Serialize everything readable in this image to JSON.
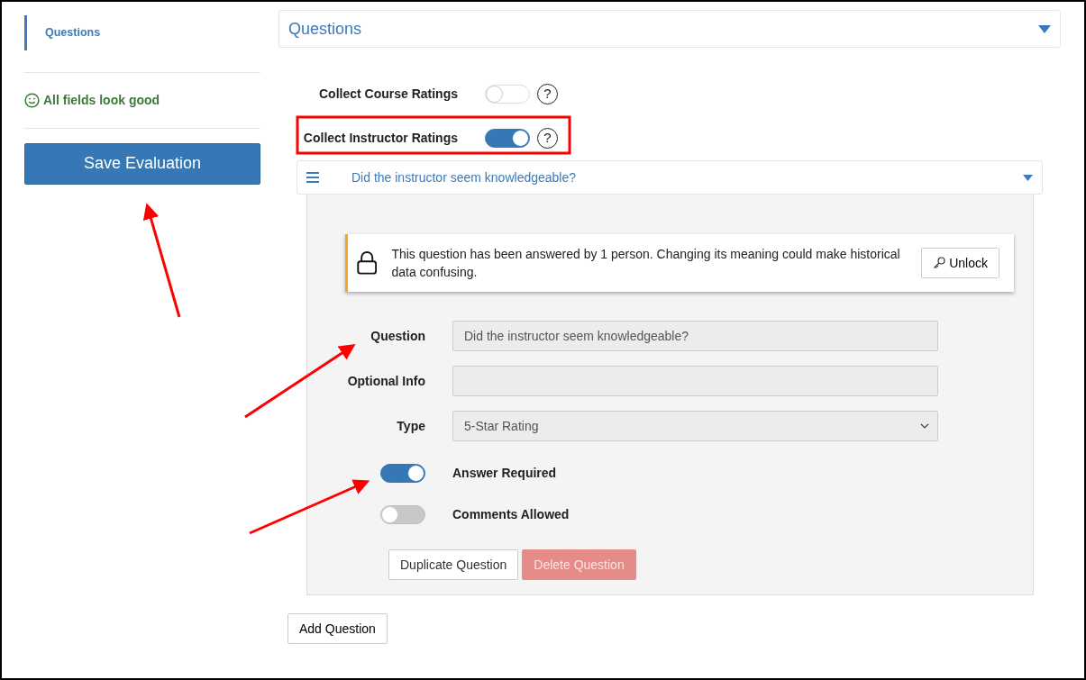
{
  "sidebar": {
    "nav_items": [
      {
        "label": "Questions",
        "selected": true
      }
    ],
    "status": "All fields look good",
    "save_button": "Save Evaluation"
  },
  "section": {
    "title": "Questions",
    "expanded": true,
    "settings": [
      {
        "label": "Collect Course Ratings",
        "on": false,
        "help": "?"
      },
      {
        "label": "Collect Instructor Ratings",
        "on": true,
        "help": "?"
      }
    ],
    "questions": [
      {
        "title": "Did the instructor seem knowledgeable?",
        "expanded": true,
        "lock_notice": {
          "message": "This question has been answered by 1 person. Changing its meaning could make historical data confusing.",
          "button": "Unlock"
        },
        "fields": [
          {
            "label": "Question",
            "kind": "text",
            "value": "Did the instructor seem knowledgeable?"
          },
          {
            "label": "Optional Info",
            "kind": "text"
          },
          {
            "label": "Type",
            "kind": "select",
            "value": "5-Star Rating"
          }
        ],
        "options": [
          {
            "label": "Answer Required",
            "on": true
          },
          {
            "label": "Comments Allowed",
            "on": false
          }
        ],
        "buttons": [
          {
            "label": "Duplicate Question",
            "kind": "secondary",
            "disabled": false
          },
          {
            "label": "Delete Question",
            "kind": "danger",
            "disabled": true
          }
        ]
      }
    ],
    "add_button": "Add Question"
  }
}
